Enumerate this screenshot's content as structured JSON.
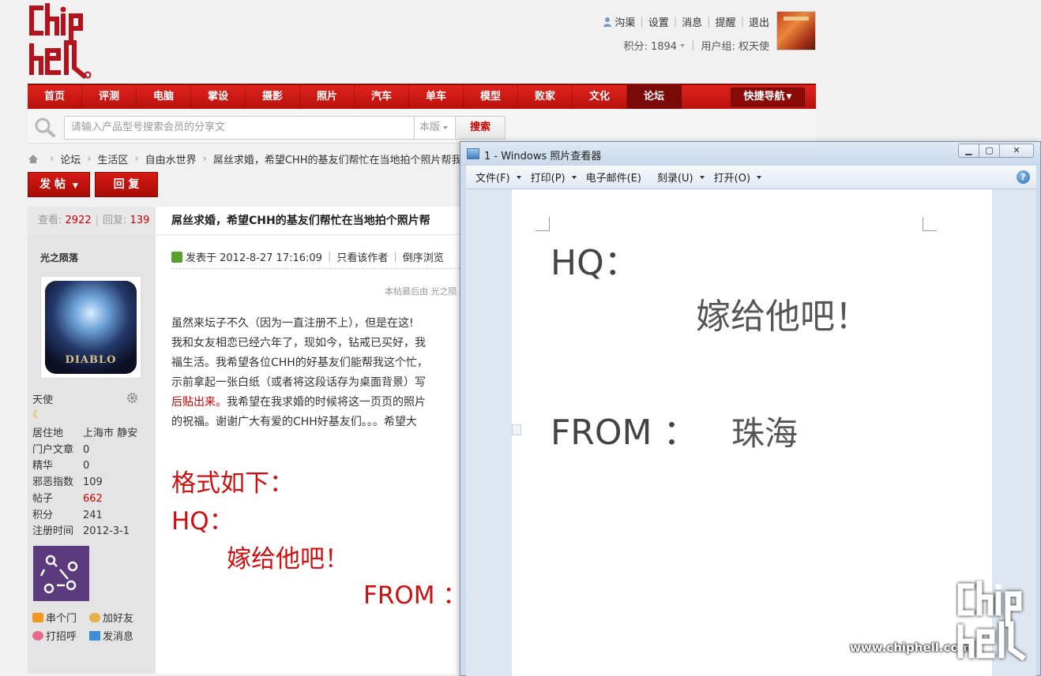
{
  "header": {
    "user_links": [
      "沟渠",
      "设置",
      "消息",
      "提醒",
      "退出"
    ],
    "score": "积分: 1894",
    "user_group": "用户组: 权天使"
  },
  "nav": {
    "items": [
      "首页",
      "评测",
      "电脑",
      "掌设",
      "摄影",
      "照片",
      "汽车",
      "单车",
      "模型",
      "败家",
      "文化",
      "论坛"
    ],
    "active": "论坛",
    "quick_nav": "快捷导航"
  },
  "search": {
    "placeholder": "请输入产品型号搜索会员的分享文",
    "scope": "本版",
    "button": "搜索"
  },
  "breadcrumb": {
    "items": [
      "论坛",
      "生活区",
      "自由水世界",
      "屌丝求婚，希望CHH的基友们帮忙在当地拍个照片帮我求"
    ]
  },
  "actions": {
    "post": "发 帖",
    "reply": "回 复"
  },
  "thread": {
    "views_label": "查看:",
    "views": "2922",
    "replies_label": "回复:",
    "replies": "139",
    "title": "屌丝求婚，希望CHH的基友们帮忙在当地拍个照片帮"
  },
  "author": {
    "name": "光之陨落",
    "avatar_text": "DIABLO",
    "rank": "天使",
    "info": [
      {
        "k": "居住地",
        "v": "上海市 静安",
        "red": false
      },
      {
        "k": "门户文章",
        "v": "0",
        "red": false
      },
      {
        "k": "精华",
        "v": "0",
        "red": false
      },
      {
        "k": "邪恶指数",
        "v": "109",
        "red": false
      },
      {
        "k": "帖子",
        "v": "662",
        "red": true
      },
      {
        "k": "积分",
        "v": "241",
        "red": false
      },
      {
        "k": "注册时间",
        "v": "2012-3-1",
        "red": false
      }
    ],
    "links": [
      "串个门",
      "加好友",
      "打招呼",
      "发消息"
    ]
  },
  "post": {
    "posted": "发表于 2012-8-27 17:16:09",
    "only_author": "只看该作者",
    "reverse": "倒序浏览",
    "edit_note": "本帖最后由 光之陨",
    "lines": [
      "  虽然来坛子不久（因为一直注册不上），但是在这!",
      "我和女友相恋已经六年了，现如今，钻戒已买好，我",
      "福生活。我希望各位CHH的好基友们能帮我这个忙，",
      "示前拿起一张白纸（或者将这段话存为桌面背景）写",
      "后贴出来。我希望在我求婚的时候将这一页页的照片",
      "的祝福。谢谢广大有爱的CHH好基友们。。。希望大"
    ],
    "line5_red": "后贴出来。",
    "line5_rest": "我希望在我求婚的时候将这一页页的照片",
    "format_label": "格式如下：",
    "hq": "HQ：",
    "marry": "嫁给他吧！",
    "from": "FROM ："
  },
  "viewer": {
    "title": "1 - Windows 照片查看器",
    "menu": [
      "文件(F)",
      "打印(P)",
      "电子邮件(E)",
      "刻录(U)",
      "打开(O)"
    ],
    "menu_has_arrow": [
      true,
      true,
      false,
      true,
      true
    ],
    "doc_hq": "HQ：",
    "doc_marry": "嫁给他吧！",
    "doc_from": "FROM ：",
    "doc_city": "珠海"
  },
  "watermark": {
    "url": "www.chiphell.com"
  },
  "colors": {
    "nav_red": "#c4140f",
    "accent_red": "#cc0000",
    "link_red": "#d01010"
  }
}
